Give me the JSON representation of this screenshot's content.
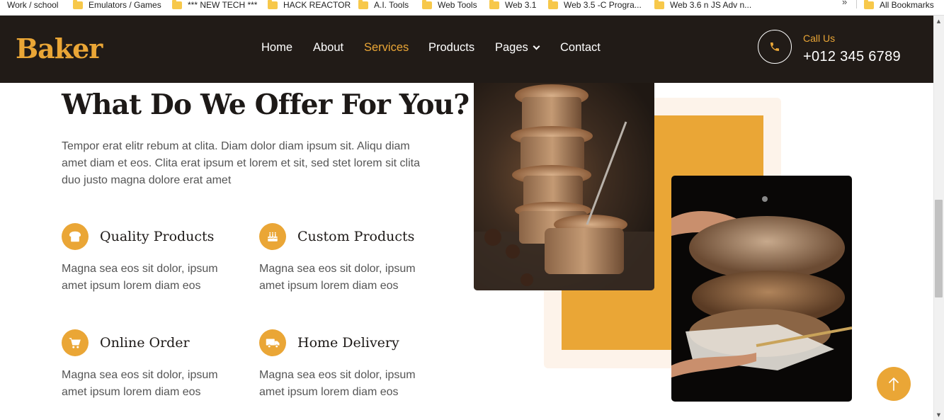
{
  "bookmarks": [
    {
      "label": "Work / school"
    },
    {
      "label": "Emulators / Games"
    },
    {
      "label": "*** NEW TECH ***"
    },
    {
      "label": "HACK REACTOR"
    },
    {
      "label": "A.I. Tools"
    },
    {
      "label": "Web Tools"
    },
    {
      "label": "Web 3.1"
    },
    {
      "label": "Web 3.5  -C Progra..."
    },
    {
      "label": "Web 3.6 n JS Adv n..."
    },
    {
      "label": "All Bookmarks"
    }
  ],
  "bookmarks_overflow": "»",
  "navbar": {
    "brand": "Baker",
    "links": [
      {
        "label": "Home"
      },
      {
        "label": "About"
      },
      {
        "label": "Services"
      },
      {
        "label": "Products"
      },
      {
        "label": "Pages"
      },
      {
        "label": "Contact"
      }
    ],
    "active": "Services",
    "call_label": "Call Us",
    "phone": "+012 345 6789"
  },
  "section": {
    "title": "What Do We Offer For You?",
    "intro": "Tempor erat elitr rebum at clita. Diam dolor diam ipsum sit. Aliqu diam amet diam et eos. Clita erat ipsum et lorem et sit, sed stet lorem sit clita duo justo magna dolore erat amet",
    "features": [
      {
        "title": "Quality Products",
        "text": "Magna sea eos sit dolor, ipsum amet ipsum lorem diam eos",
        "icon": "bread-icon"
      },
      {
        "title": "Custom Products",
        "text": "Magna sea eos sit dolor, ipsum amet ipsum lorem diam eos",
        "icon": "birthday-cake-icon"
      },
      {
        "title": "Online Order",
        "text": "Magna sea eos sit dolor, ipsum amet ipsum lorem diam eos",
        "icon": "cart-icon"
      },
      {
        "title": "Home Delivery",
        "text": "Magna sea eos sit dolor, ipsum amet ipsum lorem diam eos",
        "icon": "truck-icon"
      }
    ]
  },
  "colors": {
    "accent": "#eaa636",
    "navbar_bg": "#211b17",
    "heading": "#1d1917",
    "body_text": "#555555",
    "cream": "#fdf3ea"
  }
}
